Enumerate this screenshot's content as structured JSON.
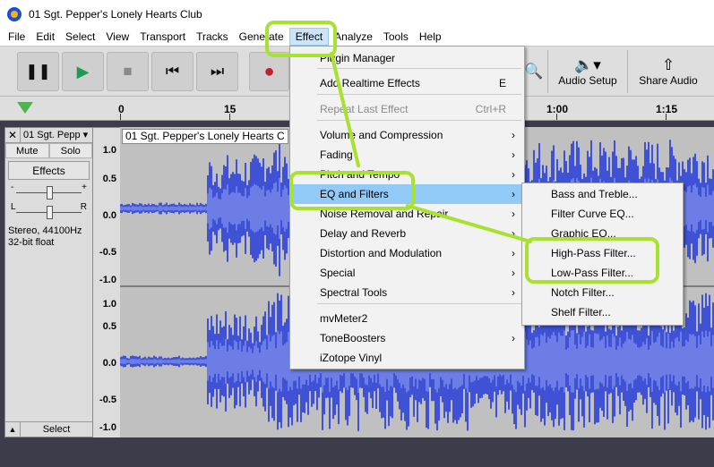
{
  "window": {
    "title": "01 Sgt. Pepper's Lonely Hearts Club",
    "icon": "audacity-icon"
  },
  "menubar": {
    "items": [
      "File",
      "Edit",
      "Select",
      "View",
      "Transport",
      "Tracks",
      "Generate",
      "Effect",
      "Analyze",
      "Tools",
      "Help"
    ],
    "active": "Effect"
  },
  "toolbar": {
    "pause_icon": "pause-icon",
    "play_icon": "play-icon",
    "stop_icon": "stop-icon",
    "skip_start_icon": "skip-to-start-icon",
    "skip_end_icon": "skip-to-end-icon",
    "record_icon": "record-icon",
    "audio_setup": "Audio Setup",
    "share_audio": "Share Audio"
  },
  "timeline": {
    "labels": [
      "0",
      "15",
      "1:00",
      "1:15"
    ]
  },
  "track": {
    "name": "01 Sgt. Pepp",
    "mute": "Mute",
    "solo": "Solo",
    "effects": "Effects",
    "gain_minus": "-",
    "gain_plus": "+",
    "pan_left": "L",
    "pan_right": "R",
    "format_line1": "Stereo, 44100Hz",
    "format_line2": "32-bit float",
    "select": "Select",
    "clip_title": "01 Sgt. Pepper's Lonely Hearts C",
    "scale_labels": [
      "1.0",
      "0.5",
      "0.0",
      "-0.5",
      "-1.0"
    ],
    "waveform_color": "#3f52d6",
    "waveform_rms_color": "#6c7ee6"
  },
  "effect_menu": {
    "items": [
      {
        "label": "Plugin Manager",
        "shortcut": "",
        "submenu": false,
        "disabled": false
      },
      {
        "label": "Add Realtime Effects",
        "shortcut": "E",
        "submenu": false,
        "disabled": false
      },
      {
        "label": "Repeat Last Effect",
        "shortcut": "Ctrl+R",
        "submenu": false,
        "disabled": true
      },
      {
        "label": "Volume and Compression",
        "shortcut": "",
        "submenu": true,
        "disabled": false
      },
      {
        "label": "Fading",
        "shortcut": "",
        "submenu": true,
        "disabled": false
      },
      {
        "label": "Pitch and Tempo",
        "shortcut": "",
        "submenu": true,
        "disabled": false
      },
      {
        "label": "EQ and Filters",
        "shortcut": "",
        "submenu": true,
        "disabled": false,
        "highlighted": true
      },
      {
        "label": "Noise Removal and Repair",
        "shortcut": "",
        "submenu": true,
        "disabled": false
      },
      {
        "label": "Delay and Reverb",
        "shortcut": "",
        "submenu": true,
        "disabled": false
      },
      {
        "label": "Distortion and Modulation",
        "shortcut": "",
        "submenu": true,
        "disabled": false
      },
      {
        "label": "Special",
        "shortcut": "",
        "submenu": true,
        "disabled": false
      },
      {
        "label": "Spectral Tools",
        "shortcut": "",
        "submenu": true,
        "disabled": false
      },
      {
        "label": "mvMeter2",
        "shortcut": "",
        "submenu": false,
        "disabled": false
      },
      {
        "label": "ToneBoosters",
        "shortcut": "",
        "submenu": true,
        "disabled": false
      },
      {
        "label": "iZotope Vinyl",
        "shortcut": "",
        "submenu": false,
        "disabled": false
      }
    ]
  },
  "eq_submenu": {
    "items": [
      "Bass and Treble...",
      "Filter Curve EQ...",
      "Graphic EQ...",
      "High-Pass Filter...",
      "Low-Pass Filter...",
      "Notch Filter...",
      "Shelf Filter..."
    ]
  },
  "annotation": {
    "color": "#a6e22e"
  }
}
